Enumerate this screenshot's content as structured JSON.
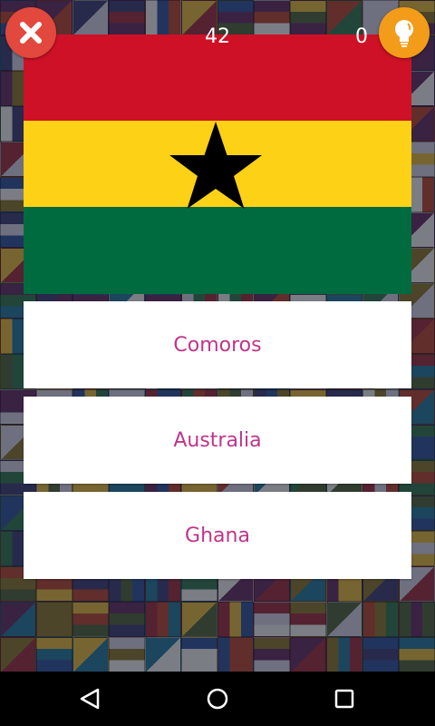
{
  "game": {
    "timer": "42",
    "score": "0"
  },
  "flag": {
    "colors": {
      "top": "#ce1126",
      "middle": "#fcd116",
      "bottom": "#006b3f",
      "star": "#000000"
    }
  },
  "answers": [
    {
      "label": "Comoros"
    },
    {
      "label": "Australia"
    },
    {
      "label": "Ghana"
    }
  ],
  "icons": {
    "close": "close-icon",
    "hint": "lightbulb-icon",
    "back": "back-triangle-icon",
    "home": "home-circle-icon",
    "recent": "recent-square-icon"
  },
  "theme": {
    "close_color": "#e2483d",
    "hint_color": "#f39c1a",
    "answer_text_color": "#c0348a"
  }
}
